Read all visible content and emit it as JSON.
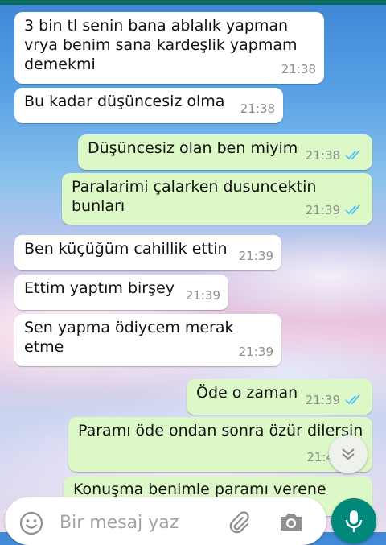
{
  "messages": [
    {
      "direction": "incoming",
      "text": "3 bin tl senin bana ablalık yapman vrya benim sana kardeşlik yapmam demekmi",
      "time": "21:38"
    },
    {
      "direction": "incoming",
      "text": "Bu kadar düşüncesiz olma",
      "time": "21:38"
    },
    {
      "direction": "outgoing",
      "text": "Düşüncesiz olan ben miyim",
      "time": "21:38",
      "status": "read"
    },
    {
      "direction": "outgoing",
      "text": "Paralarimi çalarken dusuncektin bunları",
      "time": "21:39",
      "status": "read"
    },
    {
      "direction": "incoming",
      "text": "Ben küçüğüm cahillik ettin",
      "time": "21:39"
    },
    {
      "direction": "incoming",
      "text": "Ettim yaptım birşey",
      "time": "21:39"
    },
    {
      "direction": "incoming",
      "text": "Sen yapma ödiycem merak etme",
      "time": "21:39"
    },
    {
      "direction": "outgoing",
      "text": "Öde o zaman",
      "time": "21:39",
      "status": "read"
    },
    {
      "direction": "outgoing",
      "text": "Paramı öde ondan sonra özür dilersin",
      "time": "21:4",
      "status": "read"
    },
    {
      "direction": "outgoing",
      "text": "Konuşma benimle paramı verene",
      "time": ""
    }
  ],
  "composer": {
    "placeholder": "Bir mesaj yaz",
    "icons": {
      "emoji": "emoji-icon",
      "attach": "paperclip-icon",
      "camera": "camera-icon",
      "mic": "microphone-icon"
    }
  },
  "scroll_button": {
    "icon": "chevron-double-down-icon"
  },
  "colors": {
    "incoming_bubble": "#ffffff",
    "outgoing_bubble": "#dcf8c6",
    "read_tick": "#4fc3f7",
    "accent": "#00897b",
    "header": "#0b6b5f"
  }
}
